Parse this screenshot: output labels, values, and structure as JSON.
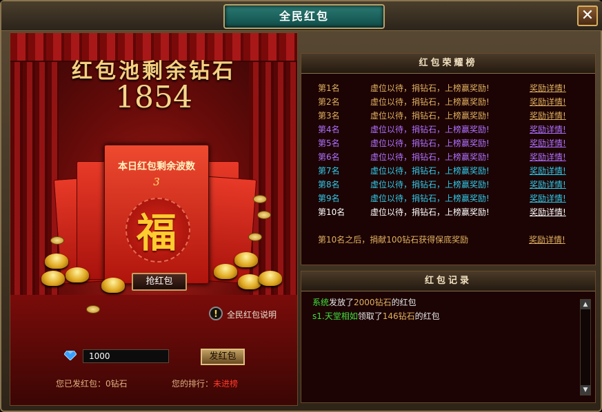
{
  "window": {
    "title": "全民红包",
    "close_icon": "close-icon"
  },
  "left": {
    "pool_title": "红包池剩余钻石",
    "pool_amount": "1854",
    "envelope_label": "本日红包剩余波数",
    "envelope_count": "3",
    "fu_char": "福",
    "grab_button": "抢红包",
    "info_text": "全民红包说明",
    "amount_input_value": "1000",
    "send_button": "发红包",
    "sent_label": "您已发红包：",
    "sent_value": "0钻石",
    "rank_label": "您的排行：",
    "rank_value": "未进榜"
  },
  "leaderboard": {
    "title": "红包荣耀榜",
    "rows": [
      {
        "rank": "第1名",
        "text": "虚位以待，捐钻石，上榜赢奖励!",
        "link": "奖励详情!"
      },
      {
        "rank": "第2名",
        "text": "虚位以待，捐钻石，上榜赢奖励!",
        "link": "奖励详情!"
      },
      {
        "rank": "第3名",
        "text": "虚位以待，捐钻石，上榜赢奖励!",
        "link": "奖励详情!"
      },
      {
        "rank": "第4名",
        "text": "虚位以待，捐钻石，上榜赢奖励!",
        "link": "奖励详情!"
      },
      {
        "rank": "第5名",
        "text": "虚位以待，捐钻石，上榜赢奖励!",
        "link": "奖励详情!"
      },
      {
        "rank": "第6名",
        "text": "虚位以待，捐钻石，上榜赢奖励!",
        "link": "奖励详情!"
      },
      {
        "rank": "第7名",
        "text": "虚位以待，捐钻石，上榜赢奖励!",
        "link": "奖励详情!"
      },
      {
        "rank": "第8名",
        "text": "虚位以待，捐钻石，上榜赢奖励!",
        "link": "奖励详情!"
      },
      {
        "rank": "第9名",
        "text": "虚位以待，捐钻石，上榜赢奖励!",
        "link": "奖励详情!"
      },
      {
        "rank": "第10名",
        "text": "虚位以待，捐钻石，上榜赢奖励!",
        "link": "奖励详情!"
      }
    ],
    "after_text": "第10名之后，捐献100钻石获得保底奖励",
    "after_link": "奖励详情!"
  },
  "log": {
    "title": "红包记录",
    "line1": {
      "actor": "系统",
      "verb": "发放了",
      "amount": "2000钻石",
      "suffix": "的红包"
    },
    "line2": {
      "actor": "s1.天堂相如",
      "verb": "领取了",
      "amount": "146钻石",
      "suffix": "的红包"
    }
  },
  "colors": {
    "rank_gold": "#e0b060",
    "rank_purple": "#b070ff",
    "rank_cyan": "#30c8e8",
    "rank_white": "#ffffff",
    "log_green": "#40e040",
    "log_amount": "#e0b060"
  }
}
